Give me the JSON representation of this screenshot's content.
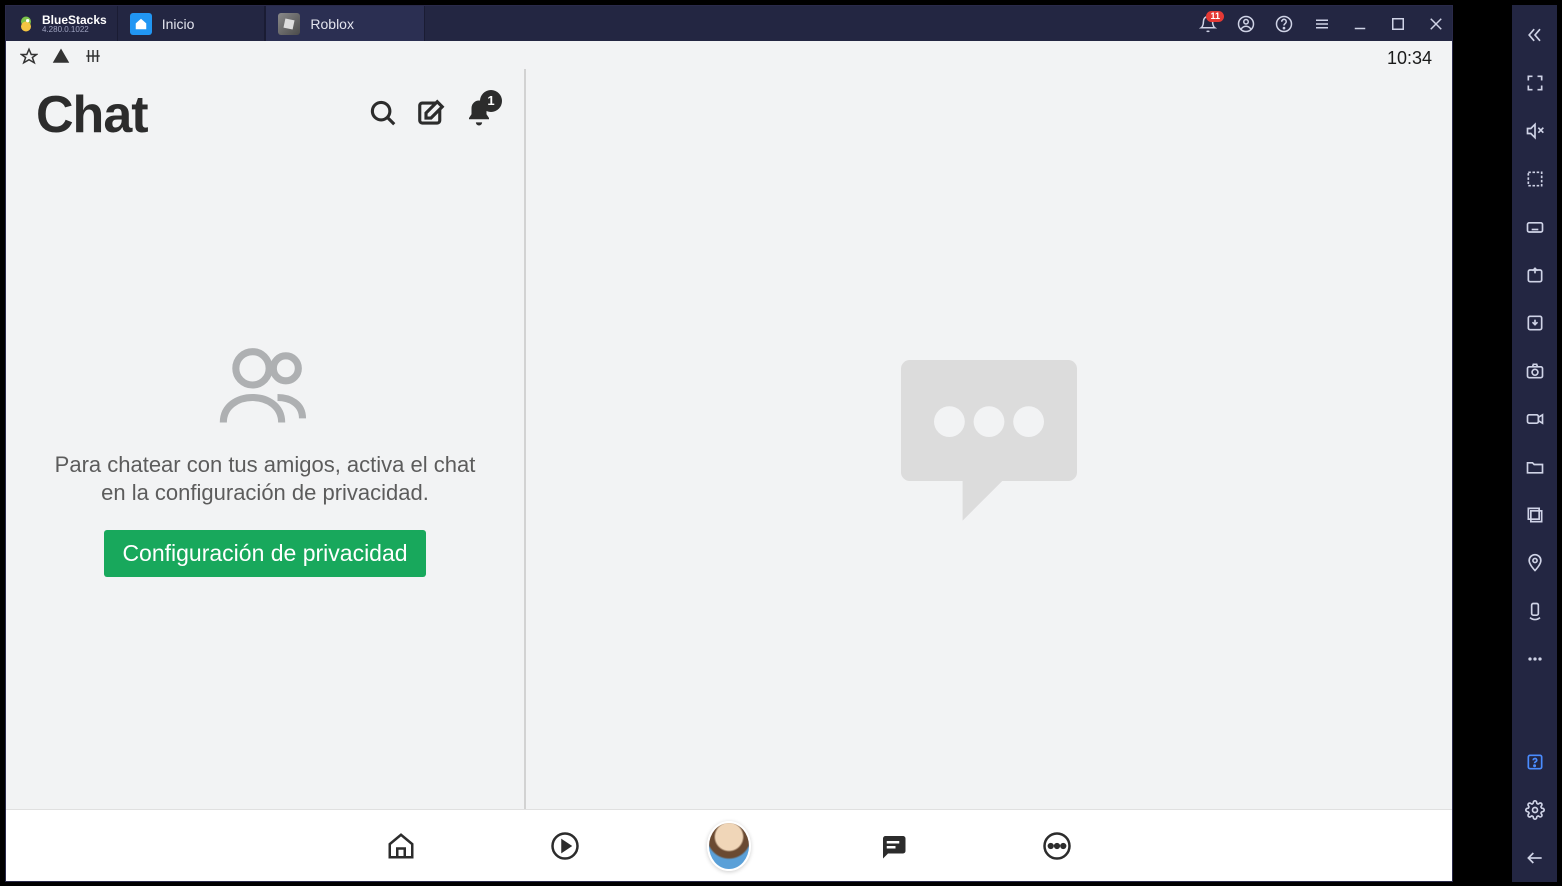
{
  "titlebar": {
    "brand_name": "BlueStacks",
    "brand_version": "4.280.0.1022",
    "tabs": [
      {
        "label": "Inicio"
      },
      {
        "label": "Roblox"
      }
    ],
    "notification_count": "11"
  },
  "status_bar": {
    "clock": "10:34"
  },
  "chat": {
    "title": "Chat",
    "notifications_count": "1",
    "empty_message": "Para chatear con tus amigos, activa el chat en la configuración de privacidad.",
    "privacy_button": "Configuración de privacidad"
  },
  "icons": {
    "search": "search-icon",
    "compose": "compose-icon",
    "bell": "bell-icon",
    "home": "home-icon",
    "discover": "discover-icon",
    "avatar": "avatar-icon",
    "chat": "chat-icon",
    "more": "more-icon"
  }
}
